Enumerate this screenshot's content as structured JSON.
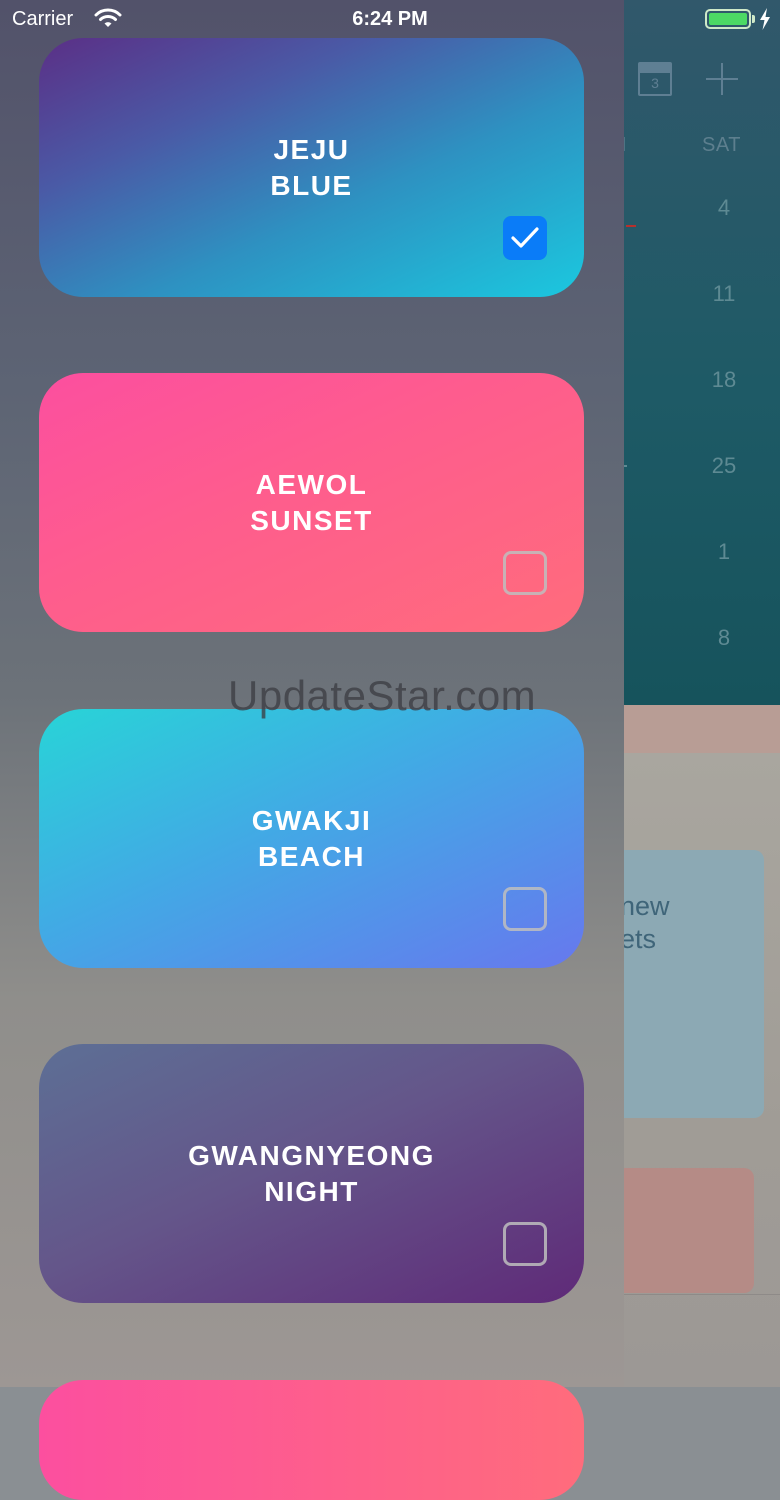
{
  "status_bar": {
    "carrier": "Carrier",
    "time": "6:24 PM",
    "battery_level": 1.0
  },
  "background_calendar": {
    "calendar_icon_day": "3",
    "weekdays": [
      "I",
      "SAT"
    ],
    "saturday_dates": [
      "4",
      "11",
      "18",
      "25",
      "1",
      "8"
    ],
    "card_text": "new\nets"
  },
  "themes": [
    {
      "line1": "JEJU",
      "line2": "BLUE",
      "checked": true
    },
    {
      "line1": "AEWOL",
      "line2": "SUNSET",
      "checked": false
    },
    {
      "line1": "GWAKJI",
      "line2": "BEACH",
      "checked": false
    },
    {
      "line1": "GWANGNYEONG",
      "line2": "NIGHT",
      "checked": false
    }
  ],
  "watermark": "UpdateStar.com",
  "colors": {
    "checkbox_checked": "#0a7cf8",
    "jeju_blue": [
      "#5b2f86",
      "#1bc8df"
    ],
    "aewol_sunset": [
      "#fc4f9f",
      "#ff6c7c"
    ],
    "gwakji_beach": [
      "#28d4d7",
      "#6778ee"
    ],
    "gwangnyeong_night": [
      "#5d6f95",
      "#5f2a78"
    ]
  }
}
